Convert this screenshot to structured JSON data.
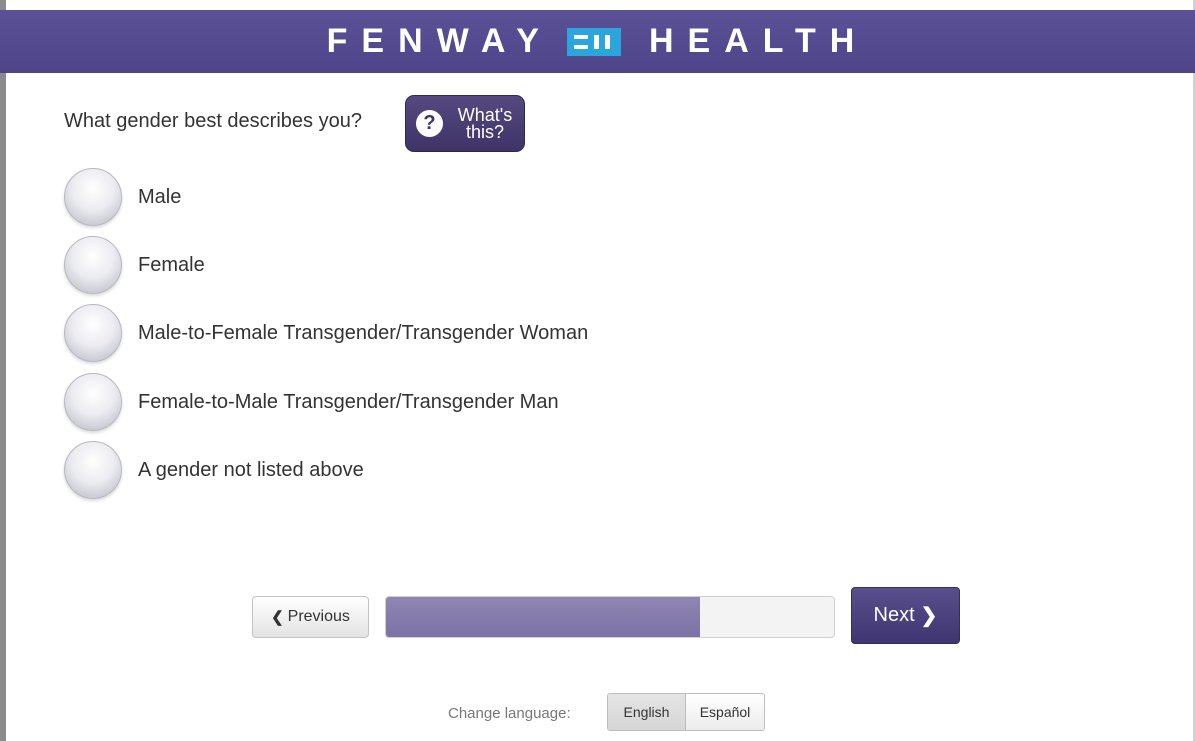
{
  "header": {
    "brand_left": "FENWAY",
    "brand_right": "HEALTH",
    "logo_icon": "fenway-logo-icon",
    "background_color": "#544a8f",
    "logo_color": "#2aa6dc"
  },
  "question": {
    "text": "What gender best describes you?",
    "help_button_label": "What's this?",
    "help_icon": "?"
  },
  "options": [
    {
      "label": "Male",
      "selected": false
    },
    {
      "label": "Female",
      "selected": false
    },
    {
      "label": "Male-to-Female Transgender/Transgender Woman",
      "selected": false
    },
    {
      "label": "Female-to-Male Transgender/Transgender Man",
      "selected": false
    },
    {
      "label": "A gender not listed above",
      "selected": false
    }
  ],
  "navigation": {
    "previous_label": "Previous",
    "next_label": "Next",
    "progress_fraction": 0.7,
    "accent_color": "#4a4080"
  },
  "language": {
    "label": "Change language:",
    "options": [
      "English",
      "Español"
    ],
    "selected": "English"
  }
}
